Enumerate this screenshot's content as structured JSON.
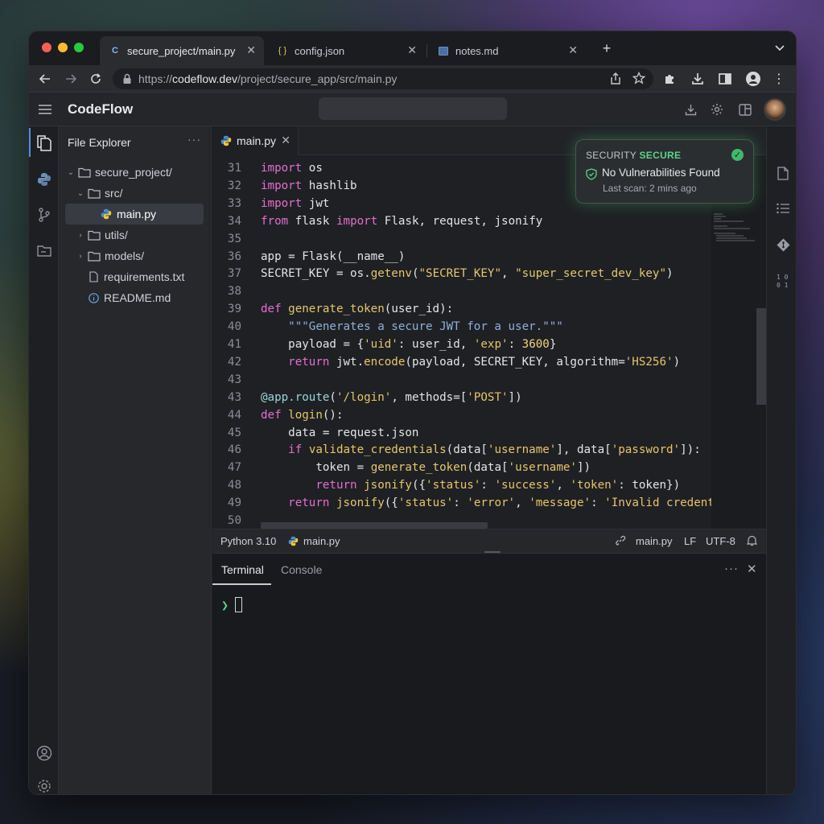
{
  "browser": {
    "tabs": [
      {
        "label": "secure_project/main.py",
        "icon": "codeflow-icon"
      },
      {
        "label": "config.json",
        "icon": "json-braces-icon"
      },
      {
        "label": "notes.md",
        "icon": "document-icon"
      }
    ],
    "url_scheme": "https://",
    "url_host": "codeflow.dev",
    "url_path": "/project/secure_app/src/main.py"
  },
  "app": {
    "title": "CodeFlow"
  },
  "explorer": {
    "title": "File Explorer",
    "items": [
      {
        "label": "secure_project/",
        "type": "folder",
        "expanded": true
      },
      {
        "label": "src/",
        "type": "folder",
        "expanded": true
      },
      {
        "label": "main.py",
        "type": "python",
        "selected": true
      },
      {
        "label": "utils/",
        "type": "folder",
        "expanded": false
      },
      {
        "label": "models/",
        "type": "folder",
        "expanded": false
      },
      {
        "label": "requirements.txt",
        "type": "text"
      },
      {
        "label": "README.md",
        "type": "info"
      }
    ]
  },
  "editor": {
    "active_tab": "main.py",
    "lines": [
      {
        "n": "31",
        "code": "import os"
      },
      {
        "n": "32",
        "code": "import hashlib"
      },
      {
        "n": "33",
        "code": "import jwt"
      },
      {
        "n": "34",
        "code": "from flask import Flask, request, jsonify"
      },
      {
        "n": "35",
        "code": ""
      },
      {
        "n": "36",
        "code": "app = Flask(__name__)"
      },
      {
        "n": "37",
        "code": "SECRET_KEY = os.getenv(\"SECRET_KEY\", \"super_secret_dev_key\")"
      },
      {
        "n": "38",
        "code": ""
      },
      {
        "n": "39",
        "code": "def generate_token(user_id):"
      },
      {
        "n": "40",
        "code": "    \"\"\"Generates a secure JWT for a user.\"\"\""
      },
      {
        "n": "41",
        "code": "    payload = {'uid': user_id, 'exp': 3600}"
      },
      {
        "n": "42",
        "code": "    return jwt.encode(payload, SECRET_KEY, algorithm='HS256')"
      },
      {
        "n": "43",
        "code": ""
      },
      {
        "n": "43",
        "code": "@app.route('/login', methods=['POST'])"
      },
      {
        "n": "44",
        "code": "def login():"
      },
      {
        "n": "45",
        "code": "    data = request.json"
      },
      {
        "n": "46",
        "code": "    if validate_credentials(data['username'], data['password']):"
      },
      {
        "n": "47",
        "code": "        token = generate_token(data['username'])"
      },
      {
        "n": "48",
        "code": "        return jsonify({'status': 'success', 'token': token})"
      },
      {
        "n": "49",
        "code": "    return jsonify({'status': 'error', 'message': 'Invalid credent"
      },
      {
        "n": "50",
        "code": ""
      }
    ]
  },
  "security": {
    "label": "SECURITY",
    "status": "SECURE",
    "message": "No Vulnerabilities Found",
    "last_scan": "Last scan: 2 mins ago"
  },
  "statusbar": {
    "language": "Python 3.10",
    "file": "main.py",
    "file_right": "main.py",
    "line_ending": "LF",
    "encoding": "UTF-8"
  },
  "terminal": {
    "tabs": [
      "Terminal",
      "Console"
    ],
    "prompt": "❯"
  },
  "colors": {
    "accent": "#4a90e2",
    "secure": "#5fd28a"
  }
}
